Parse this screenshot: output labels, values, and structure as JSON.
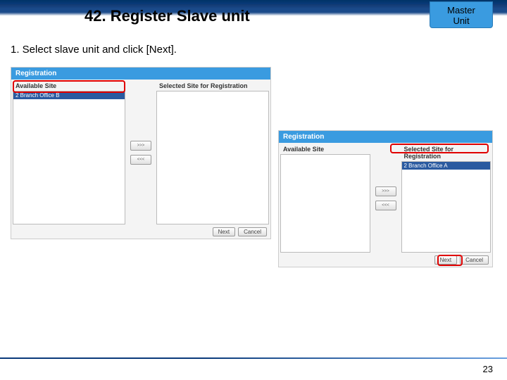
{
  "header": {
    "title": "42. Register Slave unit",
    "badge": "Master\nUnit"
  },
  "instruction": "1. Select slave unit and click [Next].",
  "panels": {
    "left": {
      "dialog_title": "Registration",
      "available_label": "Available Site",
      "selected_label": "Selected Site for Registration",
      "available_item": "2   Branch Office B",
      "add_btn": ">>>",
      "remove_btn": "<<<",
      "next_btn": "Next",
      "cancel_btn": "Cancel"
    },
    "right": {
      "dialog_title": "Registration",
      "available_label": "Available Site",
      "selected_label": "Selected Site for Registration",
      "selected_item": "2   Branch Office A",
      "add_btn": ">>>",
      "remove_btn": "<<<",
      "next_btn": "Next",
      "cancel_btn": "Cancel"
    }
  },
  "page_number": "23"
}
